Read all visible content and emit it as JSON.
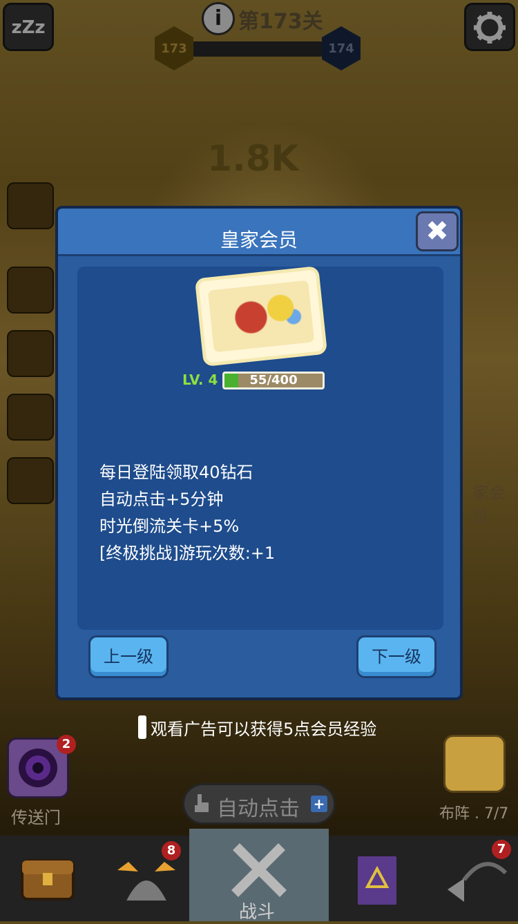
{
  "hud": {
    "stage_label": "第173关",
    "stage_current": "173",
    "stage_next": "174",
    "coin_text": "1.8K",
    "sleep_label": "zZz"
  },
  "modal": {
    "title": "皇家会员",
    "close_label": "✖",
    "level_label": "LV. 4",
    "exp_text": "55/400",
    "exp_progress": 0.1375,
    "perks": [
      "每日登陆领取40钻石",
      "自动点击+5分钟",
      "时光倒流关卡+5%",
      "[终极挑战]游玩次数:+1"
    ],
    "prev_label": "上一级",
    "next_label": "下一级"
  },
  "ad_note": "观看广告可以获得5点会员经验",
  "bottom": {
    "portal_label": "传送门",
    "portal_badge": "2",
    "auto_click_label": "自动点击",
    "formation_label": "布阵 . 7/7",
    "side_label": "家会员",
    "tabs": [
      {
        "icon": "chest-icon",
        "badge": ""
      },
      {
        "icon": "viking-helmet-icon",
        "badge": "8"
      },
      {
        "icon": "crossed-swords-icon",
        "label": "战斗"
      },
      {
        "icon": "spellbook-icon",
        "badge": ""
      },
      {
        "icon": "portal-arrow-icon",
        "badge": "7"
      }
    ]
  },
  "colors": {
    "modal_bg": "#2a5c9e",
    "header_bg": "#3a74bc",
    "exp_fill": "#4ab030",
    "button_blue": "#5ab4f0",
    "badge_red": "#b02020"
  }
}
